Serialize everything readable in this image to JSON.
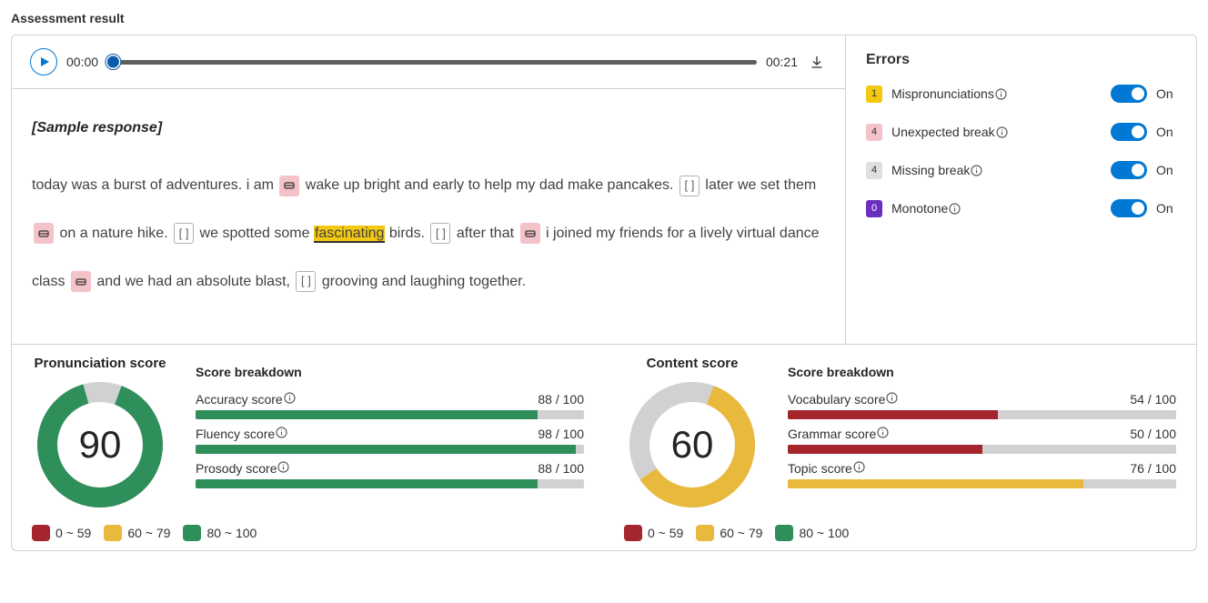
{
  "page_title": "Assessment result",
  "audio": {
    "current_time": "00:00",
    "total_time": "00:21"
  },
  "response": {
    "header": "[Sample response]",
    "tokens": [
      {
        "type": "text",
        "value": "today was a burst of adventures. i am "
      },
      {
        "type": "marker",
        "style": "unexpected"
      },
      {
        "type": "text",
        "value": " wake up bright and early to help my dad make pancakes. "
      },
      {
        "type": "marker",
        "style": "missing"
      },
      {
        "type": "text",
        "value": " later we set them "
      },
      {
        "type": "marker",
        "style": "unexpected"
      },
      {
        "type": "text",
        "value": " on a nature hike. "
      },
      {
        "type": "marker",
        "style": "missing"
      },
      {
        "type": "text",
        "value": " we spotted some "
      },
      {
        "type": "highlight",
        "value": "fascinating"
      },
      {
        "type": "text",
        "value": " birds. "
      },
      {
        "type": "marker",
        "style": "missing"
      },
      {
        "type": "text",
        "value": " after that "
      },
      {
        "type": "marker",
        "style": "unexpected"
      },
      {
        "type": "text",
        "value": " i joined my friends for a lively virtual dance class "
      },
      {
        "type": "marker",
        "style": "unexpected"
      },
      {
        "type": "text",
        "value": " and we had an absolute blast, "
      },
      {
        "type": "marker",
        "style": "missing"
      },
      {
        "type": "text",
        "value": " grooving and laughing together."
      }
    ]
  },
  "errors": {
    "title": "Errors",
    "items": [
      {
        "count": "1",
        "badge": "yellow",
        "label": "Mispronunciations",
        "state": "On"
      },
      {
        "count": "4",
        "badge": "pink",
        "label": "Unexpected break",
        "state": "On"
      },
      {
        "count": "4",
        "badge": "gray",
        "label": "Missing break",
        "state": "On"
      },
      {
        "count": "0",
        "badge": "purple",
        "label": "Monotone",
        "state": "On"
      }
    ]
  },
  "scores": {
    "breakdown_title": "Score breakdown",
    "pronunciation": {
      "title": "Pronunciation score",
      "value": 90,
      "color": "green",
      "bars": [
        {
          "label": "Accuracy score",
          "value": 88,
          "max": 100,
          "color": "green"
        },
        {
          "label": "Fluency score",
          "value": 98,
          "max": 100,
          "color": "green"
        },
        {
          "label": "Prosody score",
          "value": 88,
          "max": 100,
          "color": "green"
        }
      ]
    },
    "content": {
      "title": "Content score",
      "value": 60,
      "color": "yellow",
      "bars": [
        {
          "label": "Vocabulary score",
          "value": 54,
          "max": 100,
          "color": "red"
        },
        {
          "label": "Grammar score",
          "value": 50,
          "max": 100,
          "color": "red"
        },
        {
          "label": "Topic score",
          "value": 76,
          "max": 100,
          "color": "yellow"
        }
      ]
    },
    "legend": [
      {
        "swatch": "red",
        "label": "0 ~ 59"
      },
      {
        "swatch": "yellow",
        "label": "60 ~ 79"
      },
      {
        "swatch": "green",
        "label": "80 ~ 100"
      }
    ]
  },
  "chart_data": [
    {
      "type": "pie",
      "title": "Pronunciation score",
      "categories": [
        "score",
        "remaining"
      ],
      "values": [
        90,
        10
      ],
      "colors": [
        "#2f8f5b",
        "#d1d1d1"
      ]
    },
    {
      "type": "pie",
      "title": "Content score",
      "categories": [
        "score",
        "remaining"
      ],
      "values": [
        60,
        40
      ],
      "colors": [
        "#e8b93c",
        "#d1d1d1"
      ]
    },
    {
      "type": "bar",
      "title": "Pronunciation score breakdown",
      "categories": [
        "Accuracy score",
        "Fluency score",
        "Prosody score"
      ],
      "values": [
        88,
        98,
        88
      ],
      "ylim": [
        0,
        100
      ]
    },
    {
      "type": "bar",
      "title": "Content score breakdown",
      "categories": [
        "Vocabulary score",
        "Grammar score",
        "Topic score"
      ],
      "values": [
        54,
        50,
        76
      ],
      "ylim": [
        0,
        100
      ]
    }
  ]
}
